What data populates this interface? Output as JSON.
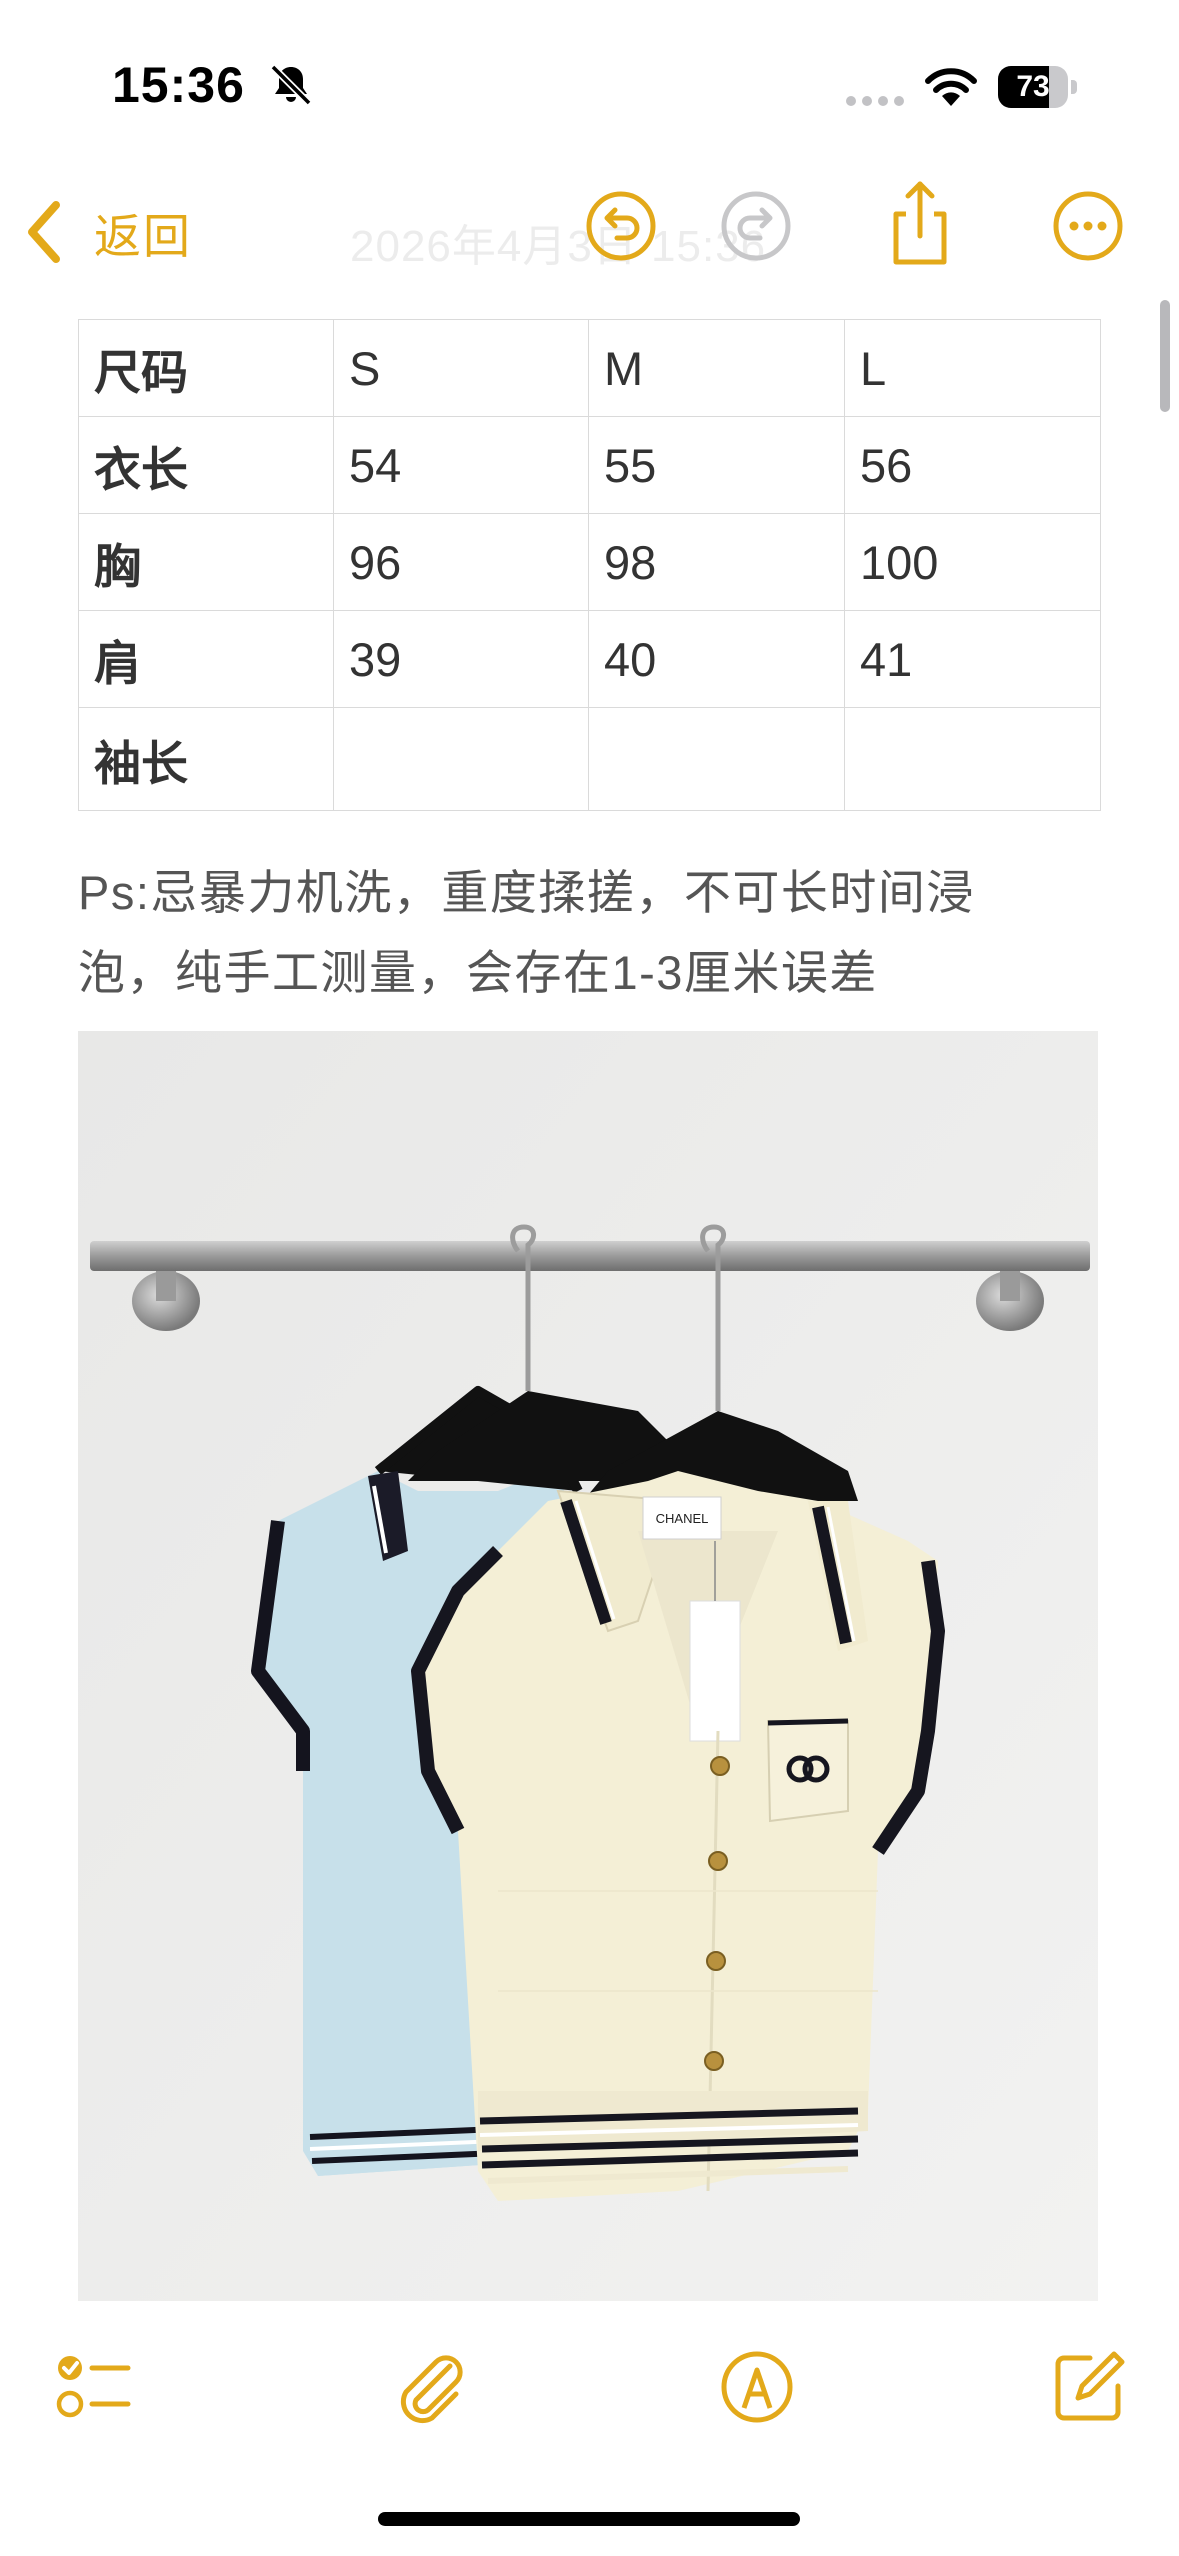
{
  "status_bar": {
    "time": "15:36",
    "battery_level": "73",
    "battery_fraction": 0.73,
    "icons": [
      "bell-slash-icon",
      "signal-dots-icon",
      "wifi-icon",
      "battery-icon"
    ]
  },
  "nav": {
    "back_label": "返回",
    "title": "2026年4月3日 15:36",
    "buttons": [
      "undo-icon",
      "redo-icon",
      "share-icon",
      "more-icon"
    ]
  },
  "size_table": {
    "header": [
      "尺码",
      "S",
      "M",
      "L"
    ],
    "rows": [
      [
        "衣长",
        "54",
        "55",
        "56"
      ],
      [
        "胸",
        "96",
        "98",
        "100"
      ],
      [
        "肩",
        "39",
        "40",
        "41"
      ],
      [
        "袖长",
        "",
        "",
        ""
      ]
    ]
  },
  "note": {
    "line1": "Ps:忌暴力机洗，重度揉搓，不可长时间浸",
    "line2": "泡，纯手工测量，会存在1-3厘米误差"
  },
  "photo": {
    "label_text": "CHANEL"
  },
  "toolbar": {
    "buttons": [
      "checklist-icon",
      "paperclip-icon",
      "markup-pen-icon",
      "compose-icon"
    ]
  },
  "colors": {
    "accent": "#E3A91A",
    "table_border": "#DADADA",
    "text": "#333333"
  }
}
